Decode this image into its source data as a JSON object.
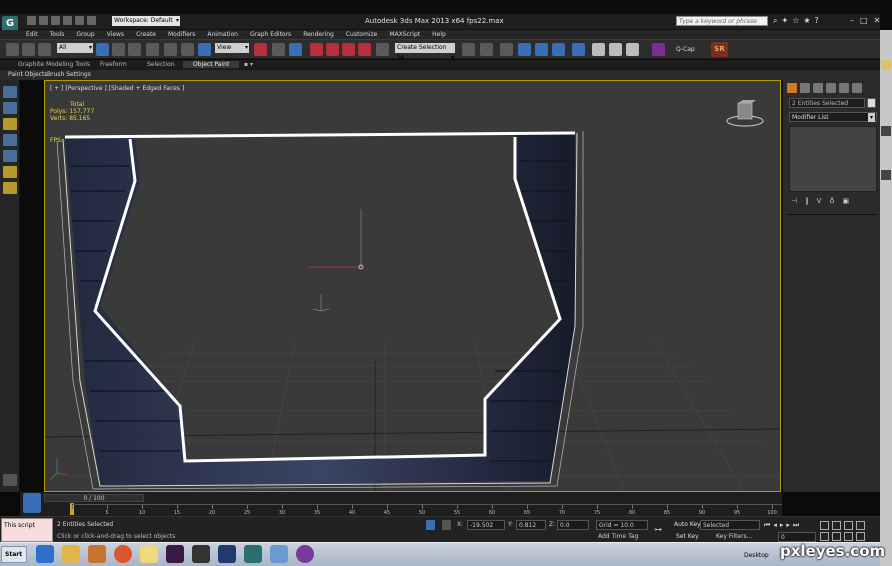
{
  "window": {
    "title": "Autodesk 3ds Max 2013 x64    fps22.max",
    "workspace": "Workspace: Default",
    "search_placeholder": "Type a keyword or phrase"
  },
  "menu": [
    "Edit",
    "Tools",
    "Group",
    "Views",
    "Create",
    "Modifiers",
    "Animation",
    "Graph Editors",
    "Rendering",
    "Customize",
    "MAXScript",
    "Help"
  ],
  "toolbar": {
    "selection_filter": "All",
    "reference_coord": "View",
    "named_selection": "Create Selection Se",
    "qcap_label": "Q-Cap",
    "sr_label": "SR"
  },
  "ribbon": {
    "tabs": [
      "Graphite Modeling Tools",
      "Freeform",
      "Selection",
      "Object Paint"
    ],
    "active_tab": "Object Paint",
    "sub_tabs": [
      "Paint Objects",
      "Brush Settings"
    ]
  },
  "viewport": {
    "label": "[ + ] [Perspective ] [Shaded + Edged Faces ]",
    "stats_header": "Total",
    "polys_label": "Polys:",
    "polys_value": "157,777",
    "verts_label": "Verts:",
    "verts_value": "85,165",
    "fps_label": "FPS:"
  },
  "command_panel": {
    "object_name": "2 Entities Selected",
    "modifier_list": "Modifier List"
  },
  "timeline": {
    "slider": "0 / 100",
    "ticks": [
      "0",
      "5",
      "10",
      "15",
      "20",
      "25",
      "30",
      "35",
      "40",
      "45",
      "50",
      "55",
      "60",
      "65",
      "70",
      "75",
      "80",
      "85",
      "90",
      "95",
      "100"
    ]
  },
  "status": {
    "script_listener": "This script",
    "selection_status": "2 Entities Selected",
    "prompt": "Click or click-and-drag to select objects",
    "x_label": "X:",
    "x_value": "-19.502",
    "y_label": "Y:",
    "y_value": "0.812",
    "z_label": "Z:",
    "z_value": "0.0",
    "grid": "Grid = 10.0",
    "add_time_tag": "Add Time Tag",
    "auto_key": "Auto Key",
    "set_key": "Set Key",
    "key_mode": "Selected",
    "key_filters": "Key Filters...",
    "frame": "0"
  },
  "taskbar": {
    "start": "Start",
    "desktop": "Desktop"
  },
  "watermark": "pxleyes.com"
}
